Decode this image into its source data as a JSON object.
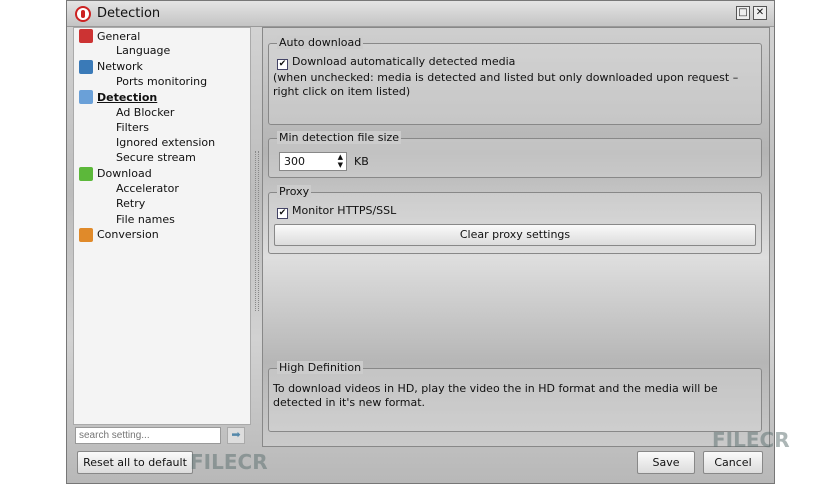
{
  "window": {
    "title": "Detection"
  },
  "tree": [
    {
      "label": "General",
      "level": 0,
      "color": "#c33"
    },
    {
      "label": "Language",
      "level": 1
    },
    {
      "label": "Network",
      "level": 0,
      "color": "#3a7ab8"
    },
    {
      "label": "Ports monitoring",
      "level": 1
    },
    {
      "label": "Detection",
      "level": 0,
      "color": "#6aa0d8",
      "selected": true
    },
    {
      "label": "Ad Blocker",
      "level": 1
    },
    {
      "label": "Filters",
      "level": 1
    },
    {
      "label": "Ignored extension",
      "level": 1
    },
    {
      "label": "Secure stream",
      "level": 1
    },
    {
      "label": "Download",
      "level": 0,
      "color": "#5cb83a"
    },
    {
      "label": "Accelerator",
      "level": 1
    },
    {
      "label": "Retry",
      "level": 1
    },
    {
      "label": "File names",
      "level": 1
    },
    {
      "label": "Conversion",
      "level": 0,
      "color": "#e08a2a"
    }
  ],
  "search": {
    "placeholder": "search setting..."
  },
  "auto_download": {
    "title": "Auto download",
    "checkbox": "Download automatically detected media",
    "checked": true,
    "note": "(when unchecked: media is detected and listed but only downloaded upon request – right click on item listed)"
  },
  "min_size": {
    "title": "Min detection file size",
    "value": "300",
    "unit": "KB"
  },
  "proxy": {
    "title": "Proxy",
    "checkbox": "Monitor HTTPS/SSL",
    "checked": true,
    "clear_button": "Clear proxy settings"
  },
  "hd": {
    "title": "High Definition",
    "text": "To download videos in HD, play the video the in HD format and the media will be detected in it's new format."
  },
  "footer": {
    "reset": "Reset all to default",
    "save": "Save",
    "cancel": "Cancel"
  },
  "watermark": "FILECR"
}
